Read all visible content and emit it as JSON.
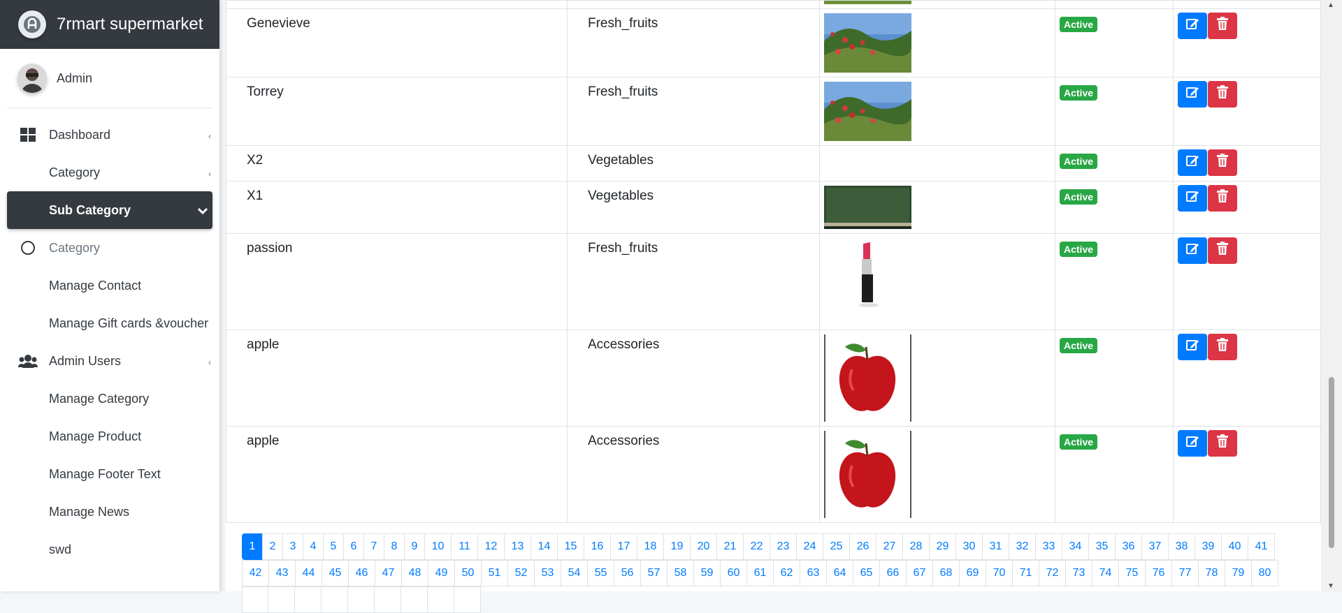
{
  "brand": {
    "title": "7rmart supermarket"
  },
  "user": {
    "name": "Admin"
  },
  "sidebar": {
    "items": [
      {
        "label": "Dashboard",
        "icon": "dashboard-icon"
      },
      {
        "label": "Category"
      },
      {
        "label": "Sub Category",
        "active": true
      },
      {
        "label": "Category",
        "icon": "circle-icon"
      },
      {
        "label": "Manage Contact"
      },
      {
        "label": "Manage Gift cards &voucher"
      },
      {
        "label": "Admin Users",
        "icon": "users-icon"
      },
      {
        "label": "Manage Category"
      },
      {
        "label": "Manage Product"
      },
      {
        "label": "Manage Footer Text"
      },
      {
        "label": "Manage News"
      },
      {
        "label": "swd"
      }
    ]
  },
  "table": {
    "status_label": "Active",
    "rows": [
      {
        "name": "Genevieve",
        "category": "Fresh_fruits",
        "image": "apple-orchard"
      },
      {
        "name": "Torrey",
        "category": "Fresh_fruits",
        "image": "apple-orchard"
      },
      {
        "name": "X2",
        "category": "Vegetables",
        "image": "none"
      },
      {
        "name": "X1",
        "category": "Vegetables",
        "image": "green-board"
      },
      {
        "name": "passion",
        "category": "Fresh_fruits",
        "image": "lipstick"
      },
      {
        "name": "apple",
        "category": "Accessories",
        "image": "red-apple"
      },
      {
        "name": "apple",
        "category": "Accessories",
        "image": "red-apple"
      }
    ]
  },
  "pagination": {
    "current": "1",
    "row1": [
      "1",
      "2",
      "3",
      "4",
      "5",
      "6",
      "7",
      "8",
      "9",
      "10",
      "11",
      "12",
      "13",
      "14",
      "15",
      "16",
      "17",
      "18",
      "19",
      "20",
      "21",
      "22",
      "23",
      "24",
      "25",
      "26",
      "27",
      "28",
      "29",
      "30",
      "31",
      "32",
      "33",
      "34",
      "35",
      "36",
      "37",
      "38",
      "39",
      "40",
      "41"
    ],
    "row2": [
      "42",
      "43",
      "44",
      "45",
      "46",
      "47",
      "48",
      "49",
      "50",
      "51",
      "52",
      "53",
      "54",
      "55",
      "56",
      "57",
      "58",
      "59",
      "60",
      "61",
      "62",
      "63",
      "64",
      "65",
      "66",
      "67",
      "68",
      "69",
      "70",
      "71",
      "72",
      "73",
      "74",
      "75",
      "76",
      "77",
      "78",
      "79",
      "80"
    ]
  },
  "colors": {
    "primary": "#007bff",
    "danger": "#dc3545",
    "success": "#28a745",
    "dark": "#343a40"
  }
}
